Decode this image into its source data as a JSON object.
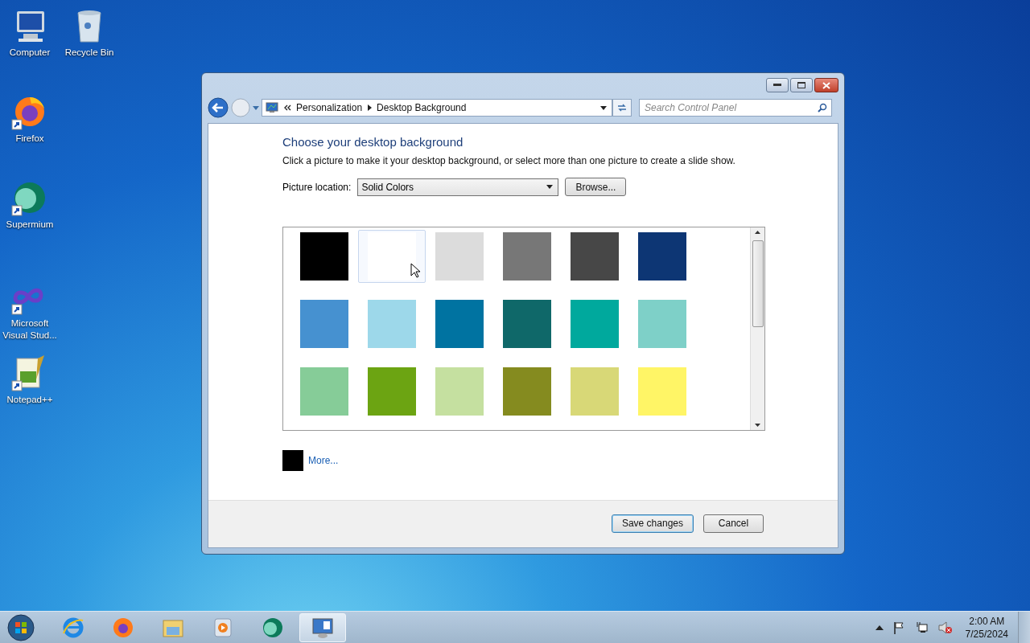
{
  "desktop_icons": [
    {
      "label": "Computer"
    },
    {
      "label": "Recycle Bin"
    },
    {
      "label": "Firefox"
    },
    {
      "label": "Supermium"
    },
    {
      "label": "Microsoft Visual Stud..."
    },
    {
      "label": "Notepad++"
    }
  ],
  "window": {
    "breadcrumb": [
      "Personalization",
      "Desktop Background"
    ],
    "search": {
      "placeholder": "Search Control Panel"
    },
    "heading": "Choose your desktop background",
    "description": "Click a picture to make it your desktop background, or select more than one picture to create a slide show.",
    "location_label": "Picture location:",
    "location_value": "Solid Colors",
    "browse_button": "Browse...",
    "swatches": [
      {
        "color": "#000000",
        "hovered": false
      },
      {
        "color": "#ffffff",
        "hovered": true
      },
      {
        "color": "#dcdcdc",
        "hovered": false
      },
      {
        "color": "#777777",
        "hovered": false
      },
      {
        "color": "#474747",
        "hovered": false
      },
      {
        "color": "#0d3674",
        "hovered": false
      },
      {
        "color": "#4691d0",
        "hovered": false
      },
      {
        "color": "#9dd8ea",
        "hovered": false
      },
      {
        "color": "#0073a1",
        "hovered": false
      },
      {
        "color": "#0f6869",
        "hovered": false
      },
      {
        "color": "#00a99d",
        "hovered": false
      },
      {
        "color": "#7ed0c8",
        "hovered": false
      },
      {
        "color": "#86cc98",
        "hovered": false
      },
      {
        "color": "#6ca412",
        "hovered": false
      },
      {
        "color": "#c5e0a0",
        "hovered": false
      },
      {
        "color": "#858b1f",
        "hovered": false
      },
      {
        "color": "#d8d877",
        "hovered": false
      },
      {
        "color": "#fff566",
        "hovered": false
      }
    ],
    "more": {
      "color": "#000000",
      "label": "More..."
    },
    "buttons": [
      "Save changes",
      "Cancel"
    ]
  },
  "taskbar": {
    "items": [
      {
        "selected": false
      },
      {
        "selected": false
      },
      {
        "selected": false
      },
      {
        "selected": false
      },
      {
        "selected": false
      },
      {
        "selected": true
      }
    ],
    "time": "2:00 AM",
    "date": "7/25/2024"
  }
}
